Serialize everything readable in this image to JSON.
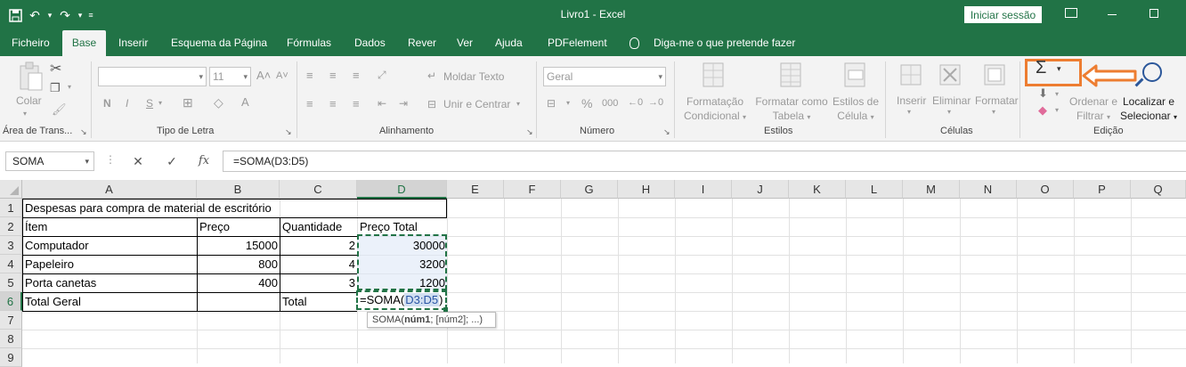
{
  "app": {
    "document_title": "Livro1  -  Excel",
    "sign_in_label": "Iniciar sessão"
  },
  "tabs": [
    "Ficheiro",
    "Base",
    "Inserir",
    "Esquema da Página",
    "Fórmulas",
    "Dados",
    "Rever",
    "Ver",
    "Ajuda",
    "PDFelement"
  ],
  "active_tab": "Base",
  "tell_me": "Diga-me o que pretende fazer",
  "ribbon": {
    "clipboard": {
      "paste_label": "Colar",
      "group_label": "Área de Trans..."
    },
    "font": {
      "font_size": "11",
      "bold": "N",
      "italic": "I",
      "underline": "S",
      "group_label": "Tipo de Letra"
    },
    "alignment": {
      "wrap_label": "Moldar Texto",
      "merge_label": "Unir e Centrar",
      "group_label": "Alinhamento"
    },
    "number": {
      "format": "Geral",
      "percent": "%",
      "thousands": "000",
      "group_label": "Número"
    },
    "styles": {
      "cond_fmt": [
        "Formatação",
        "Condicional"
      ],
      "format_table": [
        "Formatar como",
        "Tabela"
      ],
      "cell_styles": [
        "Estilos de",
        "Célula"
      ],
      "group_label": "Estilos"
    },
    "cells": {
      "insert": "Inserir",
      "delete": "Eliminar",
      "format": "Formatar",
      "group_label": "Células"
    },
    "editing": {
      "autosum_symbol": "Σ",
      "sort": [
        "Ordenar e",
        "Filtrar"
      ],
      "find": [
        "Localizar e",
        "Selecionar"
      ],
      "group_label": "Edição"
    },
    "highlight_color": "#ed7d31"
  },
  "formula_bar": {
    "name_box": "SOMA",
    "cancel": "✕",
    "enter": "✓",
    "fx": "fx",
    "formula": "=SOMA(D3:D5)"
  },
  "grid": {
    "columns": [
      "A",
      "B",
      "C",
      "D",
      "E",
      "F",
      "G",
      "H",
      "I",
      "J",
      "K",
      "L",
      "M",
      "N",
      "O",
      "P",
      "Q"
    ],
    "rows": [
      "1",
      "2",
      "3",
      "4",
      "5",
      "6",
      "7",
      "8",
      "9"
    ],
    "cells": {
      "A1": "Despesas para compra de material de escritório",
      "A2": "Ítem",
      "B2": "Preço",
      "C2": "Quantidade",
      "D2": "Preço Total",
      "A3": "Computador",
      "B3": "15000",
      "C3": "2",
      "D3": "30000",
      "A4": "Papeleiro",
      "B4": "800",
      "C4": "4",
      "D4": "3200",
      "A5": "Porta canetas",
      "B5": "400",
      "C5": "3",
      "D5": "1200",
      "A6": "Total Geral",
      "C6": "Total"
    },
    "editing_cell": {
      "ref": "D6",
      "prefix": "=SOMA(",
      "range": "D3:D5",
      "suffix": ")"
    },
    "tooltip": {
      "fn": "SOMA(",
      "arg1": "núm1",
      "rest": "; [núm2]; ...)"
    }
  }
}
